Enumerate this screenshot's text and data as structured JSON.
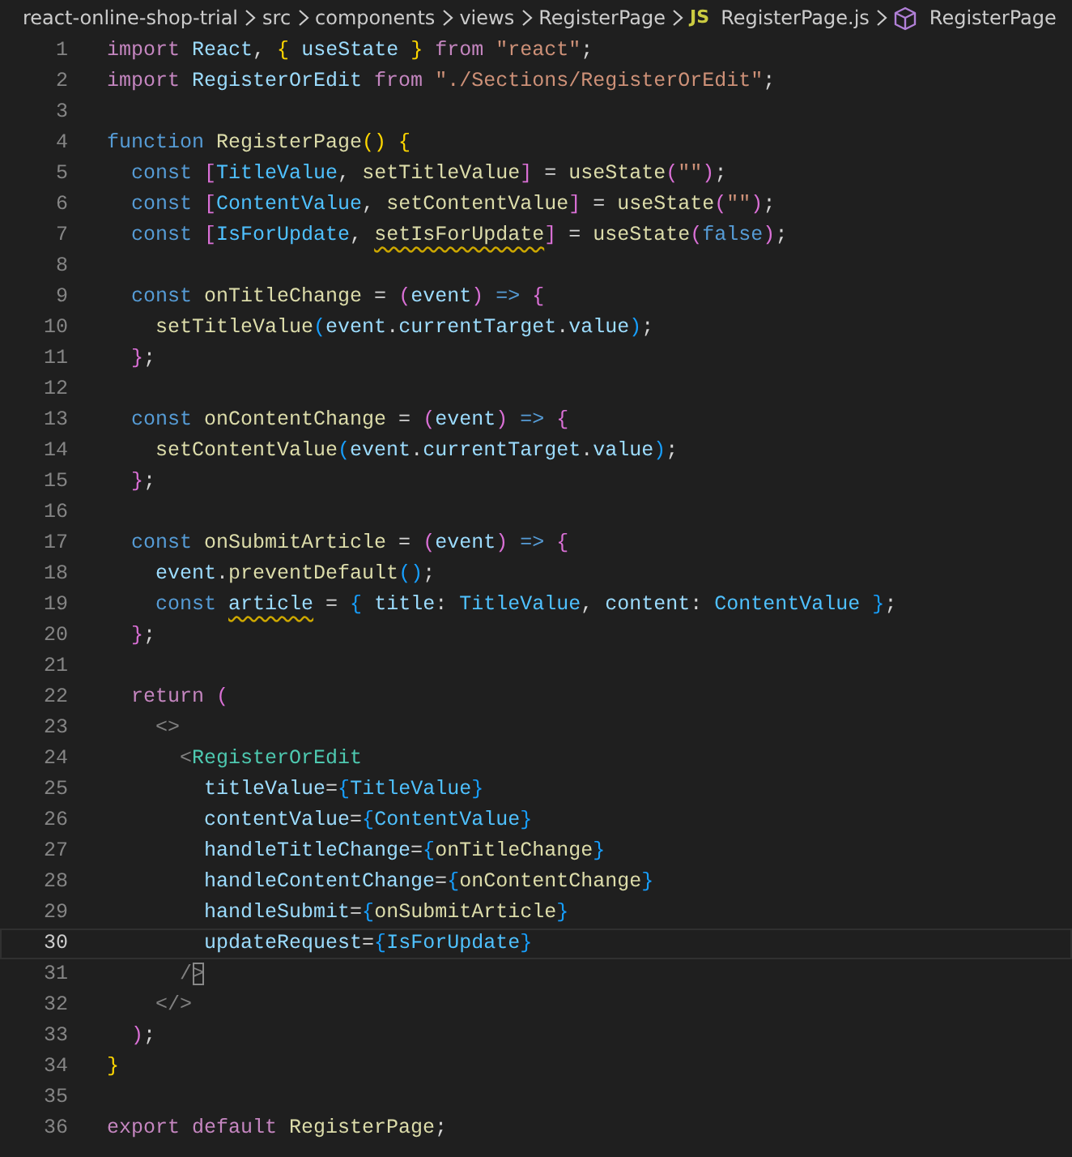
{
  "breadcrumb": [
    {
      "kind": "folder",
      "text": "react-online-shop-trial"
    },
    {
      "kind": "folder",
      "text": "src"
    },
    {
      "kind": "folder",
      "text": "components"
    },
    {
      "kind": "folder",
      "text": "views"
    },
    {
      "kind": "folder",
      "text": "RegisterPage"
    },
    {
      "kind": "file",
      "badge": "JS",
      "text": "RegisterPage.js"
    },
    {
      "kind": "symbol",
      "text": "RegisterPage"
    }
  ],
  "lines": [
    {
      "number": "1",
      "current": false,
      "tokens": [
        {
          "kind": "ctrl",
          "text": "import"
        },
        {
          "kind": "var",
          "text": " React"
        },
        {
          "kind": "p",
          "text": ", "
        },
        {
          "kind": "b1",
          "text": "{"
        },
        {
          "kind": "var",
          "text": " useState "
        },
        {
          "kind": "b1",
          "text": "}"
        },
        {
          "kind": "ctrl",
          "text": " from "
        },
        {
          "kind": "str",
          "text": "\"react\""
        },
        {
          "kind": "p",
          "text": ";"
        }
      ]
    },
    {
      "number": "2",
      "current": false,
      "tokens": [
        {
          "kind": "ctrl",
          "text": "import"
        },
        {
          "kind": "var",
          "text": " RegisterOrEdit "
        },
        {
          "kind": "ctrl",
          "text": "from "
        },
        {
          "kind": "str",
          "text": "\"./Sections/RegisterOrEdit\""
        },
        {
          "kind": "p",
          "text": ";"
        }
      ]
    },
    {
      "number": "3",
      "current": false
    },
    {
      "number": "4",
      "current": false,
      "tokens": [
        {
          "kind": "kw",
          "text": "function "
        },
        {
          "kind": "fn",
          "text": "RegisterPage"
        },
        {
          "kind": "b1",
          "text": "()"
        },
        {
          "kind": "b1",
          "text": " {"
        }
      ]
    },
    {
      "number": "5",
      "current": false,
      "tokens": [
        {
          "kind": "kw",
          "text": "  const "
        },
        {
          "kind": "b2",
          "text": "["
        },
        {
          "kind": "cst",
          "text": "TitleValue"
        },
        {
          "kind": "p",
          "text": ", "
        },
        {
          "kind": "fn",
          "text": "setTitleValue"
        },
        {
          "kind": "b2",
          "text": "]"
        },
        {
          "kind": "p",
          "text": " = "
        },
        {
          "kind": "fn",
          "text": "useState"
        },
        {
          "kind": "b2",
          "text": "("
        },
        {
          "kind": "str",
          "text": "\"\""
        },
        {
          "kind": "b2",
          "text": ")"
        },
        {
          "kind": "p",
          "text": ";"
        }
      ]
    },
    {
      "number": "6",
      "current": false,
      "tokens": [
        {
          "kind": "kw",
          "text": "  const "
        },
        {
          "kind": "b2",
          "text": "["
        },
        {
          "kind": "cst",
          "text": "ContentValue"
        },
        {
          "kind": "p",
          "text": ", "
        },
        {
          "kind": "fn",
          "text": "setContentValue"
        },
        {
          "kind": "b2",
          "text": "]"
        },
        {
          "kind": "p",
          "text": " = "
        },
        {
          "kind": "fn",
          "text": "useState"
        },
        {
          "kind": "b2",
          "text": "("
        },
        {
          "kind": "str",
          "text": "\"\""
        },
        {
          "kind": "b2",
          "text": ")"
        },
        {
          "kind": "p",
          "text": ";"
        }
      ]
    },
    {
      "number": "7",
      "current": false,
      "tokens": [
        {
          "kind": "kw",
          "text": "  const "
        },
        {
          "kind": "b2",
          "text": "["
        },
        {
          "kind": "cst",
          "text": "IsForUpdate"
        },
        {
          "kind": "p",
          "text": ", "
        },
        {
          "kind": "fnw",
          "text": "setIsForUpdate"
        },
        {
          "kind": "b2",
          "text": "]"
        },
        {
          "kind": "p",
          "text": " = "
        },
        {
          "kind": "fn",
          "text": "useState"
        },
        {
          "kind": "b2",
          "text": "("
        },
        {
          "kind": "kw",
          "text": "false"
        },
        {
          "kind": "b2",
          "text": ")"
        },
        {
          "kind": "p",
          "text": ";"
        }
      ]
    },
    {
      "number": "8",
      "current": false
    },
    {
      "number": "9",
      "current": false,
      "tokens": [
        {
          "kind": "kw",
          "text": "  const "
        },
        {
          "kind": "fn",
          "text": "onTitleChange"
        },
        {
          "kind": "p",
          "text": " = "
        },
        {
          "kind": "b2",
          "text": "("
        },
        {
          "kind": "var",
          "text": "event"
        },
        {
          "kind": "b2",
          "text": ")"
        },
        {
          "kind": "kw",
          "text": " => "
        },
        {
          "kind": "b2",
          "text": "{"
        }
      ]
    },
    {
      "number": "10",
      "current": false,
      "tokens": [
        {
          "kind": "fn",
          "text": "    setTitleValue"
        },
        {
          "kind": "b3",
          "text": "("
        },
        {
          "kind": "var",
          "text": "event"
        },
        {
          "kind": "p",
          "text": "."
        },
        {
          "kind": "var",
          "text": "currentTarget"
        },
        {
          "kind": "p",
          "text": "."
        },
        {
          "kind": "var",
          "text": "value"
        },
        {
          "kind": "b3",
          "text": ")"
        },
        {
          "kind": "p",
          "text": ";"
        }
      ]
    },
    {
      "number": "11",
      "current": false,
      "tokens": [
        {
          "kind": "b2",
          "text": "  }"
        },
        {
          "kind": "p",
          "text": ";"
        }
      ]
    },
    {
      "number": "12",
      "current": false
    },
    {
      "number": "13",
      "current": false,
      "tokens": [
        {
          "kind": "kw",
          "text": "  const "
        },
        {
          "kind": "fn",
          "text": "onContentChange"
        },
        {
          "kind": "p",
          "text": " = "
        },
        {
          "kind": "b2",
          "text": "("
        },
        {
          "kind": "var",
          "text": "event"
        },
        {
          "kind": "b2",
          "text": ")"
        },
        {
          "kind": "kw",
          "text": " => "
        },
        {
          "kind": "b2",
          "text": "{"
        }
      ]
    },
    {
      "number": "14",
      "current": false,
      "tokens": [
        {
          "kind": "fn",
          "text": "    setContentValue"
        },
        {
          "kind": "b3",
          "text": "("
        },
        {
          "kind": "var",
          "text": "event"
        },
        {
          "kind": "p",
          "text": "."
        },
        {
          "kind": "var",
          "text": "currentTarget"
        },
        {
          "kind": "p",
          "text": "."
        },
        {
          "kind": "var",
          "text": "value"
        },
        {
          "kind": "b3",
          "text": ")"
        },
        {
          "kind": "p",
          "text": ";"
        }
      ]
    },
    {
      "number": "15",
      "current": false,
      "tokens": [
        {
          "kind": "b2",
          "text": "  }"
        },
        {
          "kind": "p",
          "text": ";"
        }
      ]
    },
    {
      "number": "16",
      "current": false
    },
    {
      "number": "17",
      "current": false,
      "tokens": [
        {
          "kind": "kw",
          "text": "  const "
        },
        {
          "kind": "fn",
          "text": "onSubmitArticle"
        },
        {
          "kind": "p",
          "text": " = "
        },
        {
          "kind": "b2",
          "text": "("
        },
        {
          "kind": "var",
          "text": "event"
        },
        {
          "kind": "b2",
          "text": ")"
        },
        {
          "kind": "kw",
          "text": " => "
        },
        {
          "kind": "b2",
          "text": "{"
        }
      ]
    },
    {
      "number": "18",
      "current": false,
      "tokens": [
        {
          "kind": "var",
          "text": "    event"
        },
        {
          "kind": "p",
          "text": "."
        },
        {
          "kind": "fn",
          "text": "preventDefault"
        },
        {
          "kind": "b3",
          "text": "()"
        },
        {
          "kind": "p",
          "text": ";"
        }
      ]
    },
    {
      "number": "19",
      "current": false,
      "tokens": [
        {
          "kind": "kw",
          "text": "    const "
        },
        {
          "kind": "varw",
          "text": "article"
        },
        {
          "kind": "p",
          "text": " = "
        },
        {
          "kind": "b3",
          "text": "{"
        },
        {
          "kind": "var",
          "text": " title"
        },
        {
          "kind": "p",
          "text": ": "
        },
        {
          "kind": "cst",
          "text": "TitleValue"
        },
        {
          "kind": "p",
          "text": ", "
        },
        {
          "kind": "var",
          "text": "content"
        },
        {
          "kind": "p",
          "text": ": "
        },
        {
          "kind": "cst",
          "text": "ContentValue"
        },
        {
          "kind": "b3",
          "text": " }"
        },
        {
          "kind": "p",
          "text": ";"
        }
      ]
    },
    {
      "number": "20",
      "current": false,
      "tokens": [
        {
          "kind": "b2",
          "text": "  }"
        },
        {
          "kind": "p",
          "text": ";"
        }
      ]
    },
    {
      "number": "21",
      "current": false
    },
    {
      "number": "22",
      "current": false,
      "tokens": [
        {
          "kind": "ctrl",
          "text": "  return "
        },
        {
          "kind": "b2",
          "text": "("
        }
      ]
    },
    {
      "number": "23",
      "current": false,
      "tokens": [
        {
          "kind": "tp",
          "text": "    <>"
        }
      ]
    },
    {
      "number": "24",
      "current": false,
      "tokens": [
        {
          "kind": "tp",
          "text": "      <"
        },
        {
          "kind": "tag",
          "text": "RegisterOrEdit"
        }
      ]
    },
    {
      "number": "25",
      "current": false,
      "tokens": [
        {
          "kind": "var",
          "text": "        titleValue"
        },
        {
          "kind": "p",
          "text": "="
        },
        {
          "kind": "b3",
          "text": "{"
        },
        {
          "kind": "cst",
          "text": "TitleValue"
        },
        {
          "kind": "b3",
          "text": "}"
        }
      ]
    },
    {
      "number": "26",
      "current": false,
      "tokens": [
        {
          "kind": "var",
          "text": "        contentValue"
        },
        {
          "kind": "p",
          "text": "="
        },
        {
          "kind": "b3",
          "text": "{"
        },
        {
          "kind": "cst",
          "text": "ContentValue"
        },
        {
          "kind": "b3",
          "text": "}"
        }
      ]
    },
    {
      "number": "27",
      "current": false,
      "tokens": [
        {
          "kind": "var",
          "text": "        handleTitleChange"
        },
        {
          "kind": "p",
          "text": "="
        },
        {
          "kind": "b3",
          "text": "{"
        },
        {
          "kind": "fn",
          "text": "onTitleChange"
        },
        {
          "kind": "b3",
          "text": "}"
        }
      ]
    },
    {
      "number": "28",
      "current": false,
      "tokens": [
        {
          "kind": "var",
          "text": "        handleContentChange"
        },
        {
          "kind": "p",
          "text": "="
        },
        {
          "kind": "b3",
          "text": "{"
        },
        {
          "kind": "fn",
          "text": "onContentChange"
        },
        {
          "kind": "b3",
          "text": "}"
        }
      ]
    },
    {
      "number": "29",
      "current": false,
      "tokens": [
        {
          "kind": "var",
          "text": "        handleSubmit"
        },
        {
          "kind": "p",
          "text": "="
        },
        {
          "kind": "b3",
          "text": "{"
        },
        {
          "kind": "fn",
          "text": "onSubmitArticle"
        },
        {
          "kind": "b3",
          "text": "}"
        }
      ]
    },
    {
      "number": "30",
      "current": true,
      "tokens": [
        {
          "kind": "var",
          "text": "        updateRequest"
        },
        {
          "kind": "p",
          "text": "="
        },
        {
          "kind": "b3",
          "text": "{"
        },
        {
          "kind": "cst",
          "text": "IsForUpdate"
        },
        {
          "kind": "b3",
          "text": "}"
        }
      ]
    },
    {
      "number": "31",
      "current": false,
      "tokens": [
        {
          "kind": "tp",
          "text": "      /"
        },
        {
          "kind": "tpm",
          "text": ">"
        }
      ]
    },
    {
      "number": "32",
      "current": false,
      "tokens": [
        {
          "kind": "tp",
          "text": "    </>"
        }
      ]
    },
    {
      "number": "33",
      "current": false,
      "tokens": [
        {
          "kind": "b2",
          "text": "  )"
        },
        {
          "kind": "p",
          "text": ";"
        }
      ]
    },
    {
      "number": "34",
      "current": false,
      "tokens": [
        {
          "kind": "b1",
          "text": "}"
        }
      ]
    },
    {
      "number": "35",
      "current": false
    },
    {
      "number": "36",
      "current": false,
      "tokens": [
        {
          "kind": "ctrl",
          "text": "export default "
        },
        {
          "kind": "fn",
          "text": "RegisterPage"
        },
        {
          "kind": "p",
          "text": ";"
        }
      ]
    }
  ]
}
